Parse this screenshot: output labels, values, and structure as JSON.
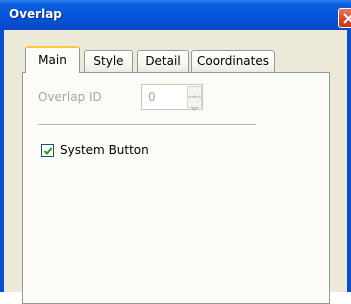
{
  "window": {
    "title": "Overlap"
  },
  "tabs": [
    {
      "label": "Main",
      "active": true
    },
    {
      "label": "Style",
      "active": false
    },
    {
      "label": "Detail",
      "active": false
    },
    {
      "label": "Coordinates",
      "active": false
    }
  ],
  "main": {
    "overlap_id_label": "Overlap ID",
    "overlap_id_value": "0",
    "overlap_id_enabled": false,
    "system_button_label": "System Button",
    "system_button_checked": true
  },
  "icons": {
    "close": "close-icon",
    "spin_up": "chevron-up-icon",
    "spin_down": "chevron-down-icon",
    "check": "checkmark-icon"
  },
  "colors": {
    "titlebar": "#0551d8",
    "close_button": "#d44a2b",
    "active_tab_highlight": "#ffc83c",
    "checkmark": "#21a121",
    "disabled_text": "#a8a99a"
  }
}
